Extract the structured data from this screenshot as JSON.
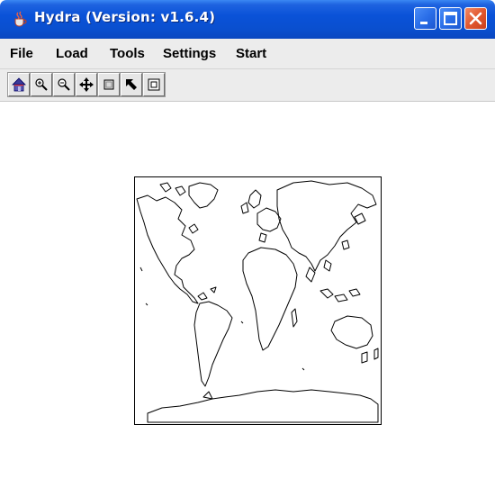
{
  "window": {
    "title": "Hydra  (Version: v1.6.4)"
  },
  "menu": {
    "items": [
      "File",
      "Load",
      "Tools",
      "Settings",
      "Start"
    ]
  },
  "toolbar": {
    "buttons": [
      "home-icon",
      "zoom-in-icon",
      "zoom-out-icon",
      "pan-icon",
      "zoom-box-icon",
      "select-arrow-icon",
      "zoom-window-icon"
    ]
  },
  "map": {
    "content": "world-map-icon"
  },
  "colors": {
    "titlebar": "#0a52d8",
    "menubar": "#ececec",
    "close_button": "#e2582f",
    "map_lines": "#000000"
  }
}
